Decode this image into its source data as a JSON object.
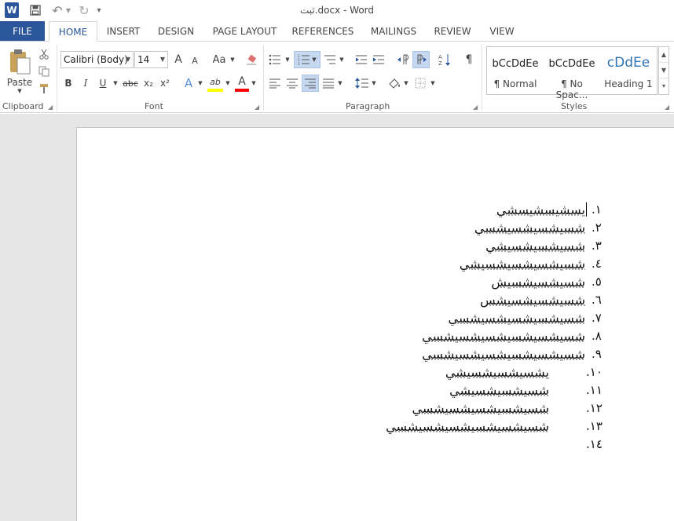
{
  "window": {
    "title": "ثبت.docx - Word"
  },
  "qat": {
    "word_icon": "W",
    "save_icon": "save-icon",
    "undo_icon": "↶",
    "redo_icon": "↻",
    "customize_icon": "▾"
  },
  "tabs": [
    "FILE",
    "HOME",
    "INSERT",
    "DESIGN",
    "PAGE LAYOUT",
    "REFERENCES",
    "MAILINGS",
    "REVIEW",
    "VIEW"
  ],
  "clipboard": {
    "paste_label": "Paste",
    "group_label": "Clipboard"
  },
  "font": {
    "name": "Calibri (Body)",
    "size": "14",
    "group_label": "Font",
    "grow": "A",
    "shrink": "A",
    "change_case": "Aa",
    "bold": "B",
    "italic": "I",
    "underline": "U",
    "strike": "abc",
    "subscript": "x₂",
    "superscript": "x²",
    "effects": "A",
    "highlight": "ab",
    "color": "A"
  },
  "paragraph": {
    "group_label": "Paragraph"
  },
  "styles": {
    "group_label": "Styles",
    "items": [
      {
        "sample": "bCcDdEe",
        "name": "¶ Normal"
      },
      {
        "sample": "bCcDdEe",
        "name": "¶ No Spac..."
      },
      {
        "sample": "cDdEe",
        "name": "Heading 1"
      }
    ]
  },
  "document": {
    "items": [
      {
        "num": ".١",
        "text": "يسشيسشيسشي"
      },
      {
        "num": ".٢",
        "text": "شسيشسيشسيشسي"
      },
      {
        "num": ".٣",
        "text": "شسيشسيشسيشي"
      },
      {
        "num": ".٤",
        "text": "شسيشسيشسيشسيشي"
      },
      {
        "num": ".٥",
        "text": "شسيشسيشسيش"
      },
      {
        "num": ".٦",
        "text": "شسيشسيشسيشس"
      },
      {
        "num": ".٧",
        "text": "شسيشسيشسيشسيشسي"
      },
      {
        "num": ".٨",
        "text": "شسيشسيشسيشسيشسيشسي"
      },
      {
        "num": ".٩",
        "text": "شسيشسيشسيشسيشسيشسي"
      },
      {
        "num": ".١٠",
        "text": "يشسيشسيشسيشي"
      },
      {
        "num": ".١١",
        "text": "شسيشسيشسيشي"
      },
      {
        "num": ".١٢",
        "text": "شسيشسيشسيشسيشسي"
      },
      {
        "num": ".١٣",
        "text": "شسيشسيشسيشسيشسيشسي"
      },
      {
        "num": ".١٤",
        "text": ""
      }
    ]
  },
  "colors": {
    "accent": "#2b579a",
    "workspace": "#e6e6e6",
    "highlight": "#ffff00",
    "font_color": "#ff0000"
  }
}
